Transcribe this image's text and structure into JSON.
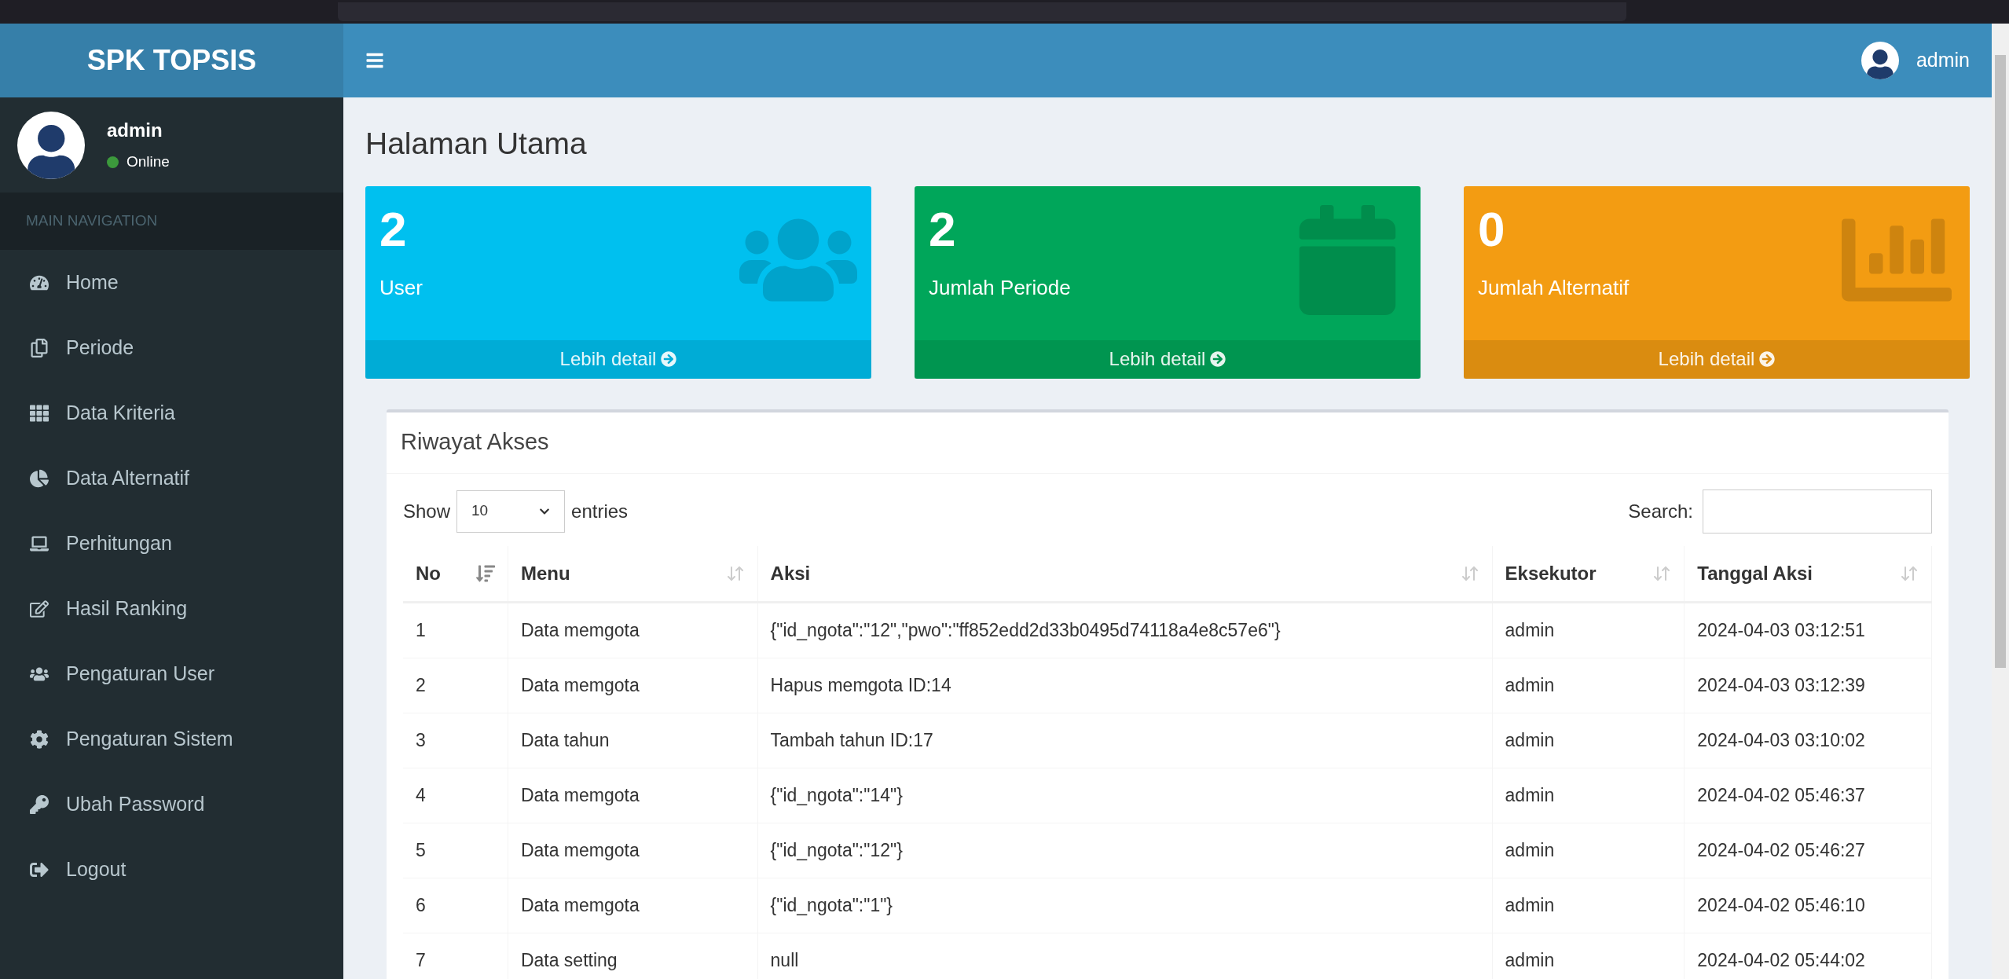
{
  "brand": "SPK TOPSIS",
  "topbar": {
    "user": "admin"
  },
  "sidebar": {
    "user": {
      "name": "admin",
      "status": "Online",
      "online": true
    },
    "header": "MAIN NAVIGATION",
    "items": [
      {
        "label": "Home"
      },
      {
        "label": "Periode"
      },
      {
        "label": "Data Kriteria"
      },
      {
        "label": "Data Alternatif"
      },
      {
        "label": "Perhitungan"
      },
      {
        "label": "Hasil Ranking"
      },
      {
        "label": "Pengaturan User"
      },
      {
        "label": "Pengaturan Sistem"
      },
      {
        "label": "Ubah Password"
      },
      {
        "label": "Logout"
      }
    ]
  },
  "page_title": "Halaman Utama",
  "cards": [
    {
      "value": "2",
      "label": "User",
      "link": "Lebih detail",
      "color": "#00c0ef"
    },
    {
      "value": "2",
      "label": "Jumlah Periode",
      "link": "Lebih detail",
      "color": "#00a65a"
    },
    {
      "value": "0",
      "label": "Jumlah Alternatif",
      "link": "Lebih detail",
      "color": "#f39c12"
    }
  ],
  "panel": {
    "title": "Riwayat Akses",
    "show_label": "Show",
    "entries_value": "10",
    "entries_label": "entries",
    "search_label": "Search:",
    "columns": [
      {
        "label": "No",
        "sorted": true
      },
      {
        "label": "Menu",
        "sorted": false
      },
      {
        "label": "Aksi",
        "sorted": false
      },
      {
        "label": "Eksekutor",
        "sorted": false
      },
      {
        "label": "Tanggal Aksi",
        "sorted": false
      }
    ],
    "rows": [
      [
        "1",
        "Data memgota",
        "{\"id_ngota\":\"12\",\"pwo\":\"ff852edd2d33b0495d74118a4e8c57e6\"}",
        "admin",
        "2024-04-03 03:12:51"
      ],
      [
        "2",
        "Data memgota",
        "Hapus memgota ID:14",
        "admin",
        "2024-04-03 03:12:39"
      ],
      [
        "3",
        "Data tahun",
        "Tambah tahun ID:17",
        "admin",
        "2024-04-03 03:10:02"
      ],
      [
        "4",
        "Data memgota",
        "{\"id_ngota\":\"14\"}",
        "admin",
        "2024-04-02 05:46:37"
      ],
      [
        "5",
        "Data memgota",
        "{\"id_ngota\":\"12\"}",
        "admin",
        "2024-04-02 05:46:27"
      ],
      [
        "6",
        "Data memgota",
        "{\"id_ngota\":\"1\"}",
        "admin",
        "2024-04-02 05:46:10"
      ],
      [
        "7",
        "Data setting",
        "null",
        "admin",
        "2024-04-02 05:44:02"
      ]
    ]
  }
}
